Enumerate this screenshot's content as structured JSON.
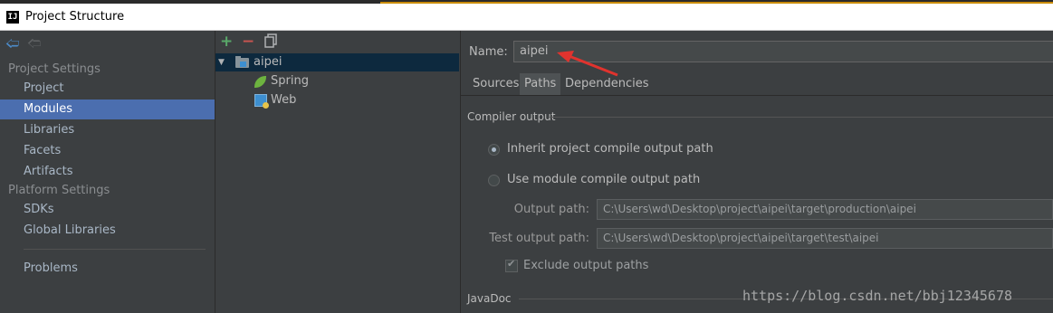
{
  "window": {
    "title": "Project Structure",
    "app_icon_text": "IJ"
  },
  "nav": {
    "back_icon": "back-arrow-icon",
    "forward_icon": "forward-arrow-icon",
    "sections": [
      {
        "title": "Project Settings",
        "items": [
          "Project",
          "Modules",
          "Libraries",
          "Facets",
          "Artifacts"
        ]
      },
      {
        "title": "Platform Settings",
        "items": [
          "SDKs",
          "Global Libraries"
        ]
      }
    ],
    "extra_item": "Problems",
    "selected": "Modules"
  },
  "tree": {
    "toolbar": {
      "add": "+",
      "remove": "−"
    },
    "nodes": [
      {
        "label": "aipei",
        "icon": "module-folder-icon",
        "expanded": true
      },
      {
        "label": "Spring",
        "icon": "spring-icon"
      },
      {
        "label": "Web",
        "icon": "web-icon"
      }
    ]
  },
  "module": {
    "name_label": "Name:",
    "name_value": "aipei",
    "tabs": [
      "Sources",
      "Paths",
      "Dependencies"
    ],
    "active_tab": "Paths",
    "compiler_output": {
      "title": "Compiler output",
      "options": [
        {
          "label": "Inherit project compile output path",
          "checked": true
        },
        {
          "label": "Use module compile output path",
          "checked": false
        }
      ],
      "output_path_label": "Output path:",
      "output_path": "C:\\Users\\wd\\Desktop\\project\\aipei\\target\\production\\aipei",
      "test_output_path_label": "Test output path:",
      "test_output_path": "C:\\Users\\wd\\Desktop\\project\\aipei\\target\\test\\aipei",
      "exclude_label": "Exclude output paths",
      "exclude_checked": true
    },
    "javadoc_title": "JavaDoc"
  },
  "watermark": "https://blog.csdn.net/bbj12345678",
  "colors": {
    "selection": "#4b6eaf",
    "tree_selection": "#0d293e",
    "annotation_arrow": "#e0332e"
  }
}
